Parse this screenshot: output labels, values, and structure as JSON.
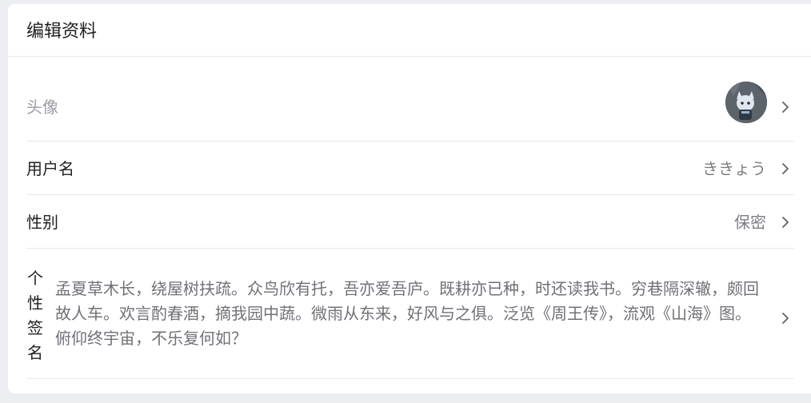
{
  "header": {
    "title": "编辑资料"
  },
  "profile": {
    "avatar": {
      "label": "头像",
      "icon": "avatar-image"
    },
    "username": {
      "label": "用户名",
      "value": "ききょう"
    },
    "gender": {
      "label": "性别",
      "value": "保密"
    },
    "signature": {
      "label_chars": [
        "个",
        "性",
        "签",
        "名"
      ],
      "value": "孟夏草木长，绕屋树扶疏。众鸟欣有托，吾亦爱吾庐。既耕亦已种，时还读我书。穷巷隔深辙，颇回故人车。欢言酌春酒，摘我园中蔬。微雨从东来，好风与之俱。泛览《周王传》，流观《山海》图。俯仰终宇宙，不乐复何如？"
    }
  },
  "icons": {
    "chevron": "chevron-right-icon"
  },
  "colors": {
    "background": "#eceef1",
    "card": "#ffffff",
    "divider": "#e8e9ec",
    "text_primary": "#1f1f1f",
    "text_secondary": "#7d7f85",
    "text_muted": "#9a9ca3"
  }
}
